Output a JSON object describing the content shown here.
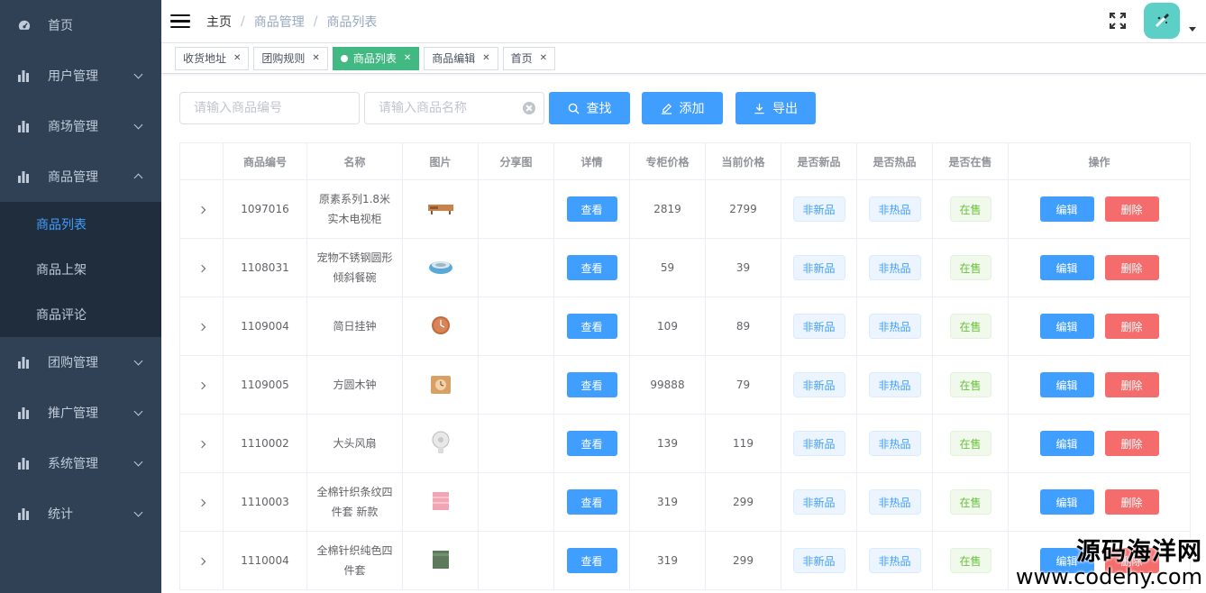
{
  "sidebar": {
    "items": [
      {
        "label": "首页",
        "icon": "dashboard-icon",
        "has_arrow": false
      },
      {
        "label": "用户管理",
        "icon": "chart-icon",
        "has_arrow": true
      },
      {
        "label": "商场管理",
        "icon": "chart-icon",
        "has_arrow": true
      },
      {
        "label": "商品管理",
        "icon": "chart-icon",
        "has_arrow": true,
        "expanded": true
      }
    ],
    "sub_items": [
      "商品列表",
      "商品上架",
      "商品评论"
    ],
    "items_after": [
      {
        "label": "团购管理",
        "icon": "chart-icon"
      },
      {
        "label": "推广管理",
        "icon": "chart-icon"
      },
      {
        "label": "系统管理",
        "icon": "chart-icon"
      },
      {
        "label": "统计",
        "icon": "chart-icon"
      }
    ]
  },
  "header": {
    "breadcrumb": [
      "主页",
      "商品管理",
      "商品列表"
    ],
    "separator": "/"
  },
  "tags": [
    {
      "label": "收货地址",
      "active": false
    },
    {
      "label": "团购规则",
      "active": false
    },
    {
      "label": "商品列表",
      "active": true
    },
    {
      "label": "商品编辑",
      "active": false
    },
    {
      "label": "首页",
      "active": false
    }
  ],
  "filter": {
    "code_placeholder": "请输入商品编号",
    "name_placeholder": "请输入商品名称",
    "search_label": "查找",
    "add_label": "添加",
    "export_label": "导出"
  },
  "table": {
    "columns": [
      "",
      "商品编号",
      "名称",
      "图片",
      "分享图",
      "详情",
      "专柜价格",
      "当前价格",
      "是否新品",
      "是否热品",
      "是否在售",
      "操作"
    ],
    "rows": [
      {
        "id": "1097016",
        "name": "原素系列1.8米实木电视柜",
        "img": "tv-cabinet",
        "detail": "查看",
        "counter_price": "2819",
        "current_price": "2799",
        "is_new": "非新品",
        "is_hot": "非热品",
        "on_sale": "在售"
      },
      {
        "id": "1108031",
        "name": "宠物不锈钢圆形倾斜餐碗",
        "img": "pet-bowl",
        "detail": "查看",
        "counter_price": "59",
        "current_price": "39",
        "is_new": "非新品",
        "is_hot": "非热品",
        "on_sale": "在售"
      },
      {
        "id": "1109004",
        "name": "简日挂钟",
        "img": "wall-clock",
        "detail": "查看",
        "counter_price": "109",
        "current_price": "89",
        "is_new": "非新品",
        "is_hot": "非热品",
        "on_sale": "在售"
      },
      {
        "id": "1109005",
        "name": "方圆木钟",
        "img": "wood-clock",
        "detail": "查看",
        "counter_price": "99888",
        "current_price": "79",
        "is_new": "非新品",
        "is_hot": "非热品",
        "on_sale": "在售"
      },
      {
        "id": "1110002",
        "name": "大头风扇",
        "img": "fan",
        "detail": "查看",
        "counter_price": "139",
        "current_price": "119",
        "is_new": "非新品",
        "is_hot": "非热品",
        "on_sale": "在售"
      },
      {
        "id": "1110003",
        "name": "全棉针织条纹四件套 新款",
        "img": "bedding-pink",
        "detail": "查看",
        "counter_price": "319",
        "current_price": "299",
        "is_new": "非新品",
        "is_hot": "非热品",
        "on_sale": "在售"
      },
      {
        "id": "1110004",
        "name": "全棉针织纯色四件套",
        "img": "bedding-green",
        "detail": "查看",
        "counter_price": "319",
        "current_price": "299",
        "is_new": "非新品",
        "is_hot": "非热品",
        "on_sale": "在售"
      }
    ],
    "edit_label": "编辑",
    "delete_label": "删除"
  },
  "watermark": {
    "line1": "源码海洋网",
    "line2": "www.codehy.com"
  },
  "colors": {
    "sidebar_bg": "#304156",
    "submenu_bg": "#1f2d3d",
    "primary": "#409eff",
    "danger": "#f56c6c",
    "success": "#67c23a",
    "tag_active": "#42b983",
    "avatar_bg": "#5ccfc6"
  }
}
